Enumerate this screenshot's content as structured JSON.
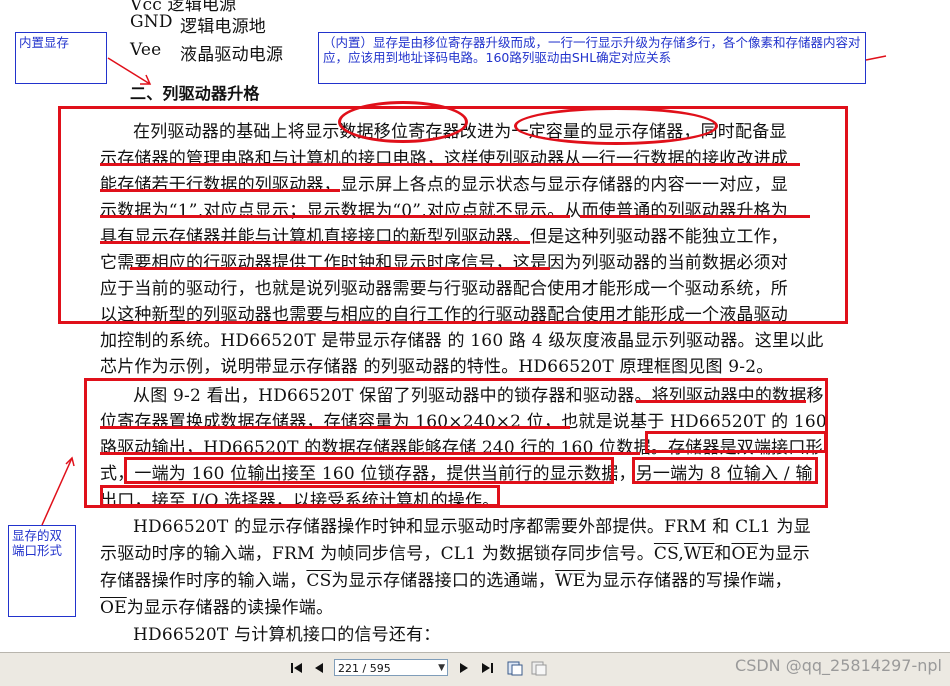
{
  "document": {
    "top_line_partial": "Vcc   逻辑电源",
    "pin_gnd": "GND",
    "pin_gnd_desc": "逻辑电源地",
    "pin_vee": "Vee",
    "pin_vee_desc": "液晶驱动电源",
    "section_heading": "二、列驱动器升格",
    "para1": [
      "在列驱动器的基础上将显示数据移位寄存器改进为一定容量的显示存储器，同时配备显",
      "示存储器的管理电路和与计算机的接口电路，这样使列驱动器从一行一行数据的接收改进成",
      "能存储若干行数据的列驱动器，显示屏上各点的显示状态与显示存储器的内容一一对应，显",
      "示数据为“1”,对应点显示；显示数据为“0”,对应点就不显示。从而使普通的列驱动器升格为",
      "具有显示存储器并能与计算机直接接口的新型列驱动器。但是这种列驱动器不能独立工作，",
      "它需要相应的行驱动器提供工作时钟和显示时序信号，这是因为列驱动器的当前数据必须对",
      "应于当前的驱动行，也就是说列驱动器需要与行驱动器配合使用才能形成一个驱动系统，所",
      "以这种新型的列驱动器也需要与相应的自行工作的行驱动器配合使用才能形成一个液晶驱动",
      "加控制的系统。HD66520T 是带显示存储器 的 160 路 4 级灰度液晶显示列驱动器。这里以此",
      "芯片作为示例，说明带显示存储器 的列驱动器的特性。HD66520T 原理框图见图 9-2。"
    ],
    "para2": [
      "从图 9-2 看出，HD66520T 保留了列驱动器中的锁存器和驱动器。将列驱动器中的数据移",
      "位寄存器置换成数据存储器，存储容量为 160×240×2 位，也就是说基于 HD66520T 的 160",
      "路驱动输出，HD66520T 的数据存储器能够存储 240 行的 160 位数据。存储器是双端接口形",
      "式，一端为 160 位输出接至 160 位锁存器，提供当前行的显示数据，另一端为 8 位输入 / 输",
      "出口，接至 I/O 选择器，以接受系统计算机的操作。"
    ],
    "para3_l1": "HD66520T 的显示存储器操作时钟和显示驱动时序都需要外部提供。FRM 和 CL1 为显",
    "para3_l2_a": "示驱动时序的输入端，FRM 为帧同步信号，CL1 为数据锁存同步信号。",
    "sig_cs": "CS",
    "sig_we": "WE",
    "sig_and": "和",
    "sig_oe": "OE",
    "para3_l2_b": "为显示",
    "para3_l3_a": "存储器操作时序的输入端，",
    "para3_l3_b": "为显示存储器接口的选通端，",
    "para3_l3_c": "为显示存储器的写操作端，",
    "para3_l4_b": "为显示存储器的读操作端。",
    "para4": "HD66520T 与计算机接口的信号还有："
  },
  "annotations": {
    "note_builtin": "内置显存",
    "note_detail": "（内置）显存是由移位寄存器升级而成，一行一行显示升级为存储多行，各个像素和存储器内容对应，应该用到地址译码电路。160路列驱动由SHL确定对应关系",
    "note_dualport": "显存的双端口形式",
    "annotation_color": "#e0101a",
    "note_color": "#2233cc"
  },
  "toolbar": {
    "first_icon": "first-page-icon",
    "prev_icon": "prev-page-icon",
    "page_indicator": "221 / 595",
    "next_icon": "next-page-icon",
    "last_icon": "last-page-icon",
    "btn1_icon": "view-mode-icon",
    "btn2_icon": "view-mode-alt-icon"
  },
  "watermark": "CSDN @qq_25814297-npl"
}
